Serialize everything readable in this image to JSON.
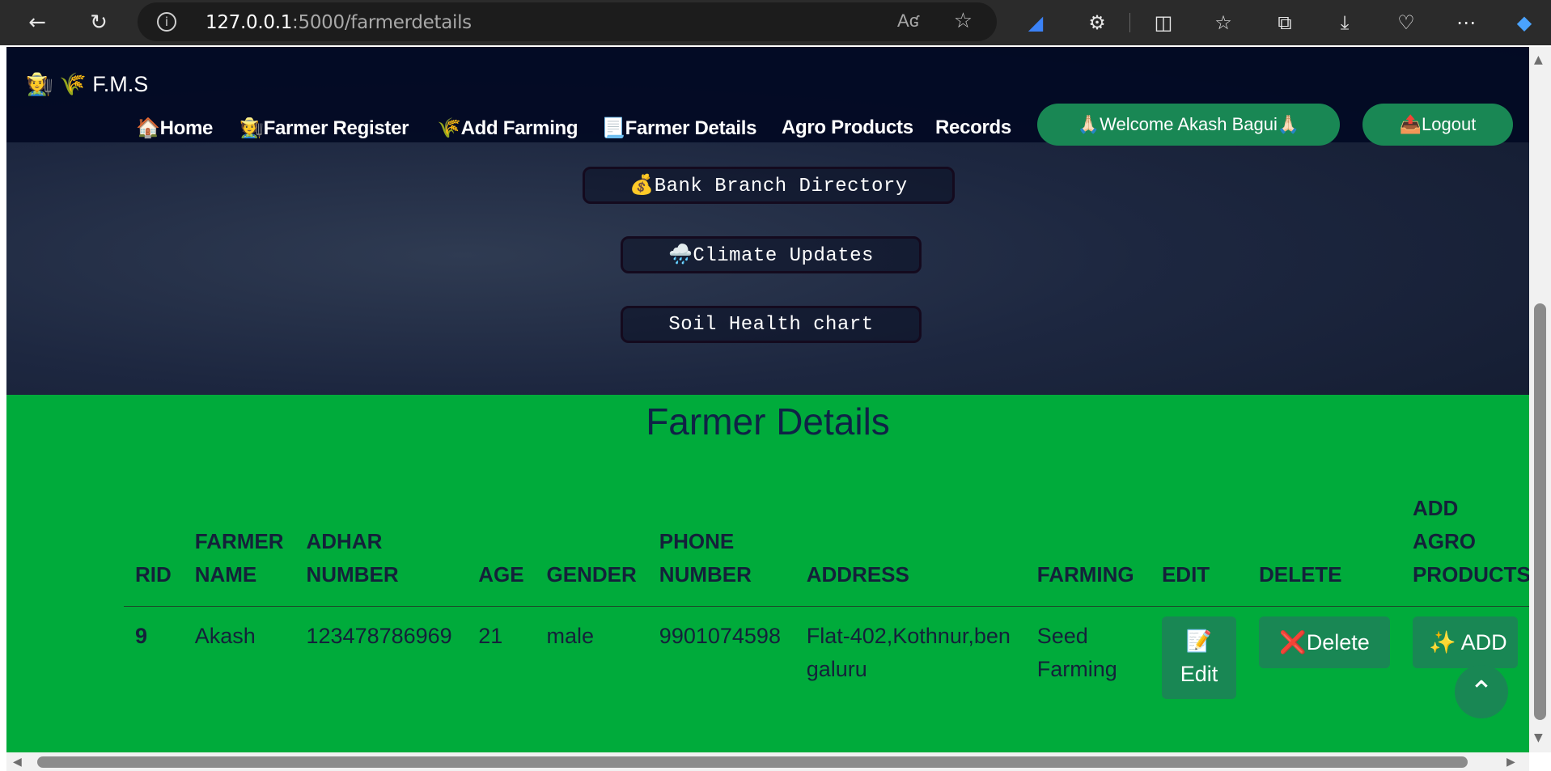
{
  "browser": {
    "url_host": "127.0.0.1",
    "url_path": ":5000/farmerdetails",
    "read_aloud": "A̅",
    "colors": {
      "frame": "#2b2b2b",
      "address_bar": "#1c1c1c"
    }
  },
  "navbar": {
    "brand": "🧑‍🌾 🌾 F.M.S",
    "links": [
      {
        "label": "🏠Home"
      },
      {
        "label": "🧑‍🌾Farmer Register"
      },
      {
        "label": "🌾Add Farming"
      },
      {
        "label": "📃Farmer Details"
      },
      {
        "label": "Agro Products"
      },
      {
        "label": "Records"
      }
    ],
    "welcome": "🙏🏻Welcome Akash Bagui🙏🏻",
    "logout": "📤Logout"
  },
  "hero": {
    "buttons": [
      {
        "label": "💰Bank Branch Directory"
      },
      {
        "label": "🌧️Climate Updates"
      },
      {
        "label": "Soil Health chart"
      }
    ]
  },
  "farmer_details": {
    "title": "Farmer Details",
    "headers": [
      "RID",
      "FARMER NAME",
      "ADHAR NUMBER",
      "AGE",
      "GENDER",
      "PHONE NUMBER",
      "ADDRESS",
      "FARMING",
      "EDIT",
      "DELETE",
      "ADD AGRO PRODUCTS"
    ],
    "rows": [
      {
        "rid": "9",
        "name": "Akash",
        "adhar": "123478786969",
        "age": "21",
        "gender": "male",
        "phone": "9901074598",
        "address": "Flat-402,Kothnur,bengaluru",
        "farming": "Seed Farming",
        "edit_label": "Edit",
        "delete_label": "❌Delete",
        "add_label": "ADD"
      }
    ]
  },
  "icons": {
    "back": "back-arrow-icon",
    "refresh": "refresh-icon",
    "info": "info-icon",
    "favorite": "star-icon",
    "scroll_top": "chevron-up-icon",
    "edit": "memo-icon"
  },
  "colors": {
    "green_section": "#00ab3b",
    "button_green": "#198754",
    "title_text": "#0f2346",
    "navbar": "#020a24"
  }
}
